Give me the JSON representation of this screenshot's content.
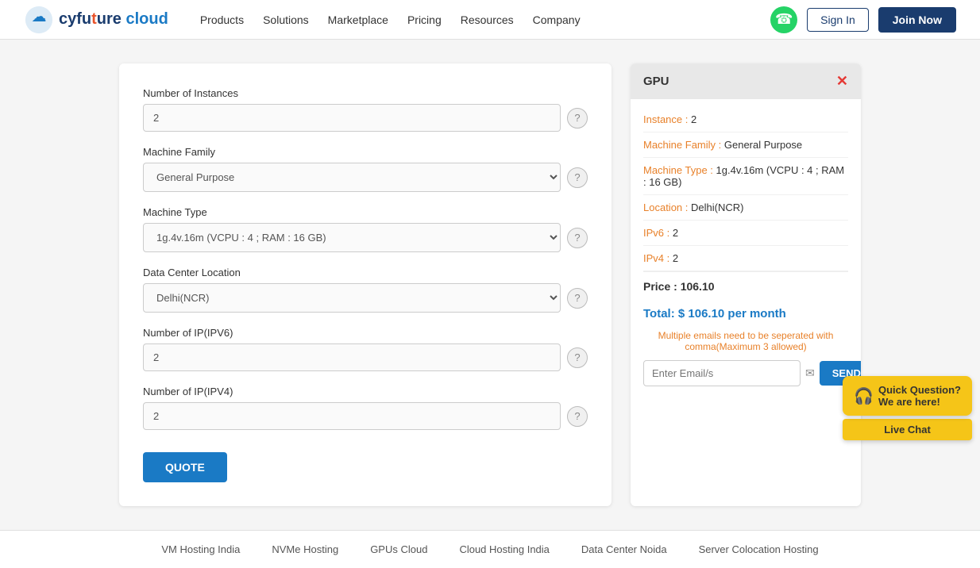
{
  "navbar": {
    "logo_text_main": "cyfuture",
    "logo_text_accent": "cloud",
    "nav_links": [
      {
        "label": "Products",
        "id": "nav-products"
      },
      {
        "label": "Solutions",
        "id": "nav-solutions"
      },
      {
        "label": "Marketplace",
        "id": "nav-marketplace"
      },
      {
        "label": "Pricing",
        "id": "nav-pricing"
      },
      {
        "label": "Resources",
        "id": "nav-resources"
      },
      {
        "label": "Company",
        "id": "nav-company"
      }
    ],
    "signin_label": "Sign In",
    "joinnow_label": "Join Now"
  },
  "form": {
    "instances_label": "Number of Instances",
    "instances_value": "2",
    "machine_family_label": "Machine Family",
    "machine_family_placeholder": "General Purpose",
    "machine_type_label": "Machine Type",
    "machine_type_placeholder": "1g.4v.16m (VCPU : 4 ; RAM : 16 GB)",
    "datacenter_label": "Data Center Location",
    "datacenter_placeholder": "Delhi(NCR)",
    "ipv6_label": "Number of IP(IPV6)",
    "ipv6_value": "2",
    "ipv4_label": "Number of IP(IPV4)",
    "ipv4_value": "2",
    "quote_label": "QUOTE"
  },
  "summary": {
    "title": "GPU",
    "instance_label": "Instance :",
    "instance_value": "2",
    "machine_family_label": "Machine Family :",
    "machine_family_value": "General Purpose",
    "machine_type_label": "Machine Type :",
    "machine_type_value": "1g.4v.16m (VCPU : 4 ; RAM : 16 GB)",
    "location_label": "Location :",
    "location_value": "Delhi(NCR)",
    "ipv6_label": "IPv6 :",
    "ipv6_value": "2",
    "ipv4_label": "IPv4 :",
    "ipv4_value": "2",
    "price_label": "Price :",
    "price_value": "106.10",
    "total_label": "Total: $ 106.10 per month",
    "email_note": "Multiple emails need to be seperated with comma(Maximum 3 allowed)",
    "email_placeholder": "Enter Email/s",
    "send_label": "SEND"
  },
  "footer": {
    "links": [
      {
        "label": "VM Hosting India"
      },
      {
        "label": "NVMe Hosting"
      },
      {
        "label": "GPUs Cloud"
      },
      {
        "label": "Cloud Hosting India"
      },
      {
        "label": "Data Center Noida"
      },
      {
        "label": "Server Colocation Hosting"
      }
    ]
  },
  "quick_chat": {
    "bubble_text": "Quick Question?\nWe are here!",
    "live_chat": "Live Chat"
  }
}
